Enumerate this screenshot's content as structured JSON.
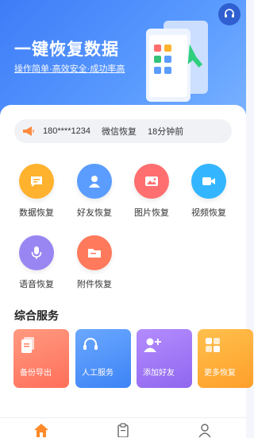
{
  "hero": {
    "title": "一键恢复数据",
    "subtitle": "操作简单·高效安全·成功率高"
  },
  "notice": {
    "phone": "180****1234",
    "action": "微信恢复",
    "time": "18分钟前"
  },
  "features": [
    {
      "label": "数据恢复",
      "icon": "chat-bubble-icon",
      "color": "#ffb22e"
    },
    {
      "label": "好友恢复",
      "icon": "friend-avatar-icon",
      "color": "#5b9dff"
    },
    {
      "label": "图片恢复",
      "icon": "picture-icon",
      "color": "#ff6f6f"
    },
    {
      "label": "视频恢复",
      "icon": "video-camera-icon",
      "color": "#33b6ff"
    },
    {
      "label": "语音恢复",
      "icon": "microphone-icon",
      "color": "#9a86f2"
    },
    {
      "label": "附件恢复",
      "icon": "folder-icon",
      "color": "#ff7a5c"
    }
  ],
  "services": {
    "title": "综合服务",
    "items": [
      {
        "label": "备份导出",
        "icon": "document-icon",
        "color": "#ff8a6e"
      },
      {
        "label": "人工服务",
        "icon": "headset-icon",
        "color": "#4f93ff"
      },
      {
        "label": "添加好友",
        "icon": "add-user-icon",
        "color": "#a57bf5"
      },
      {
        "label": "更多恢复",
        "icon": "more-grid-icon",
        "color": "#ffad3a"
      }
    ]
  },
  "tabs": [
    {
      "icon": "home-icon",
      "active": true
    },
    {
      "icon": "clipboard-icon",
      "active": false
    },
    {
      "icon": "profile-icon",
      "active": false
    }
  ]
}
